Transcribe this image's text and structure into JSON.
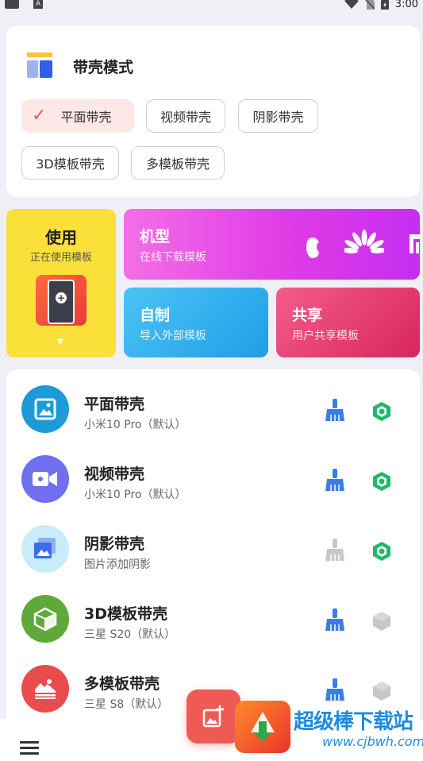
{
  "status_bar": {
    "time": "3:00",
    "icons": [
      "notification-icon",
      "a-icon",
      "wifi-icon",
      "no-sim-icon",
      "battery-icon"
    ]
  },
  "mode": {
    "title": "带壳模式",
    "chips": [
      {
        "label": "平面带壳",
        "selected": true
      },
      {
        "label": "视频带壳",
        "selected": false
      },
      {
        "label": "阴影带壳",
        "selected": false
      },
      {
        "label": "3D模板带壳",
        "selected": false
      },
      {
        "label": "多模板带壳",
        "selected": false
      }
    ]
  },
  "tiles": {
    "use": {
      "title": "使用",
      "subtitle": "正在使用模板"
    },
    "model": {
      "title": "机型",
      "subtitle": "在线下载模板"
    },
    "custom": {
      "title": "自制",
      "subtitle": "导入外部模板"
    },
    "share": {
      "title": "共享",
      "subtitle": "用户共享模板"
    }
  },
  "list": [
    {
      "title": "平面带壳",
      "subtitle": "小米10 Pro（默认）",
      "icon": "image-icon",
      "color": "#1e9bd7",
      "brush_active": true,
      "hex_active": true
    },
    {
      "title": "视频带壳",
      "subtitle": "小米10 Pro（默认）",
      "icon": "video-icon",
      "color": "#6f6ff0",
      "brush_active": true,
      "hex_active": true
    },
    {
      "title": "阴影带壳",
      "subtitle": "图片添加阴影",
      "icon": "layered-image-icon",
      "color": "#c8edf8",
      "brush_active": false,
      "hex_active": true
    },
    {
      "title": "3D模板带壳",
      "subtitle": "三星 S20（默认）",
      "icon": "cube-icon",
      "color": "#5fa83a",
      "brush_active": true,
      "hex_active": false
    },
    {
      "title": "多模板带壳",
      "subtitle": "三星 S8（默认）",
      "icon": "multi-image-icon",
      "color": "#e84c4c",
      "brush_active": true,
      "hex_active": false
    }
  ],
  "watermark": {
    "text": "超级棒下载站",
    "url": "www.cjbwh.com"
  },
  "colors": {
    "accent_red": "#f05a55",
    "brush_blue": "#3a7de8",
    "hex_green": "#1fb86a",
    "inactive_gray": "#c8c8c8"
  }
}
